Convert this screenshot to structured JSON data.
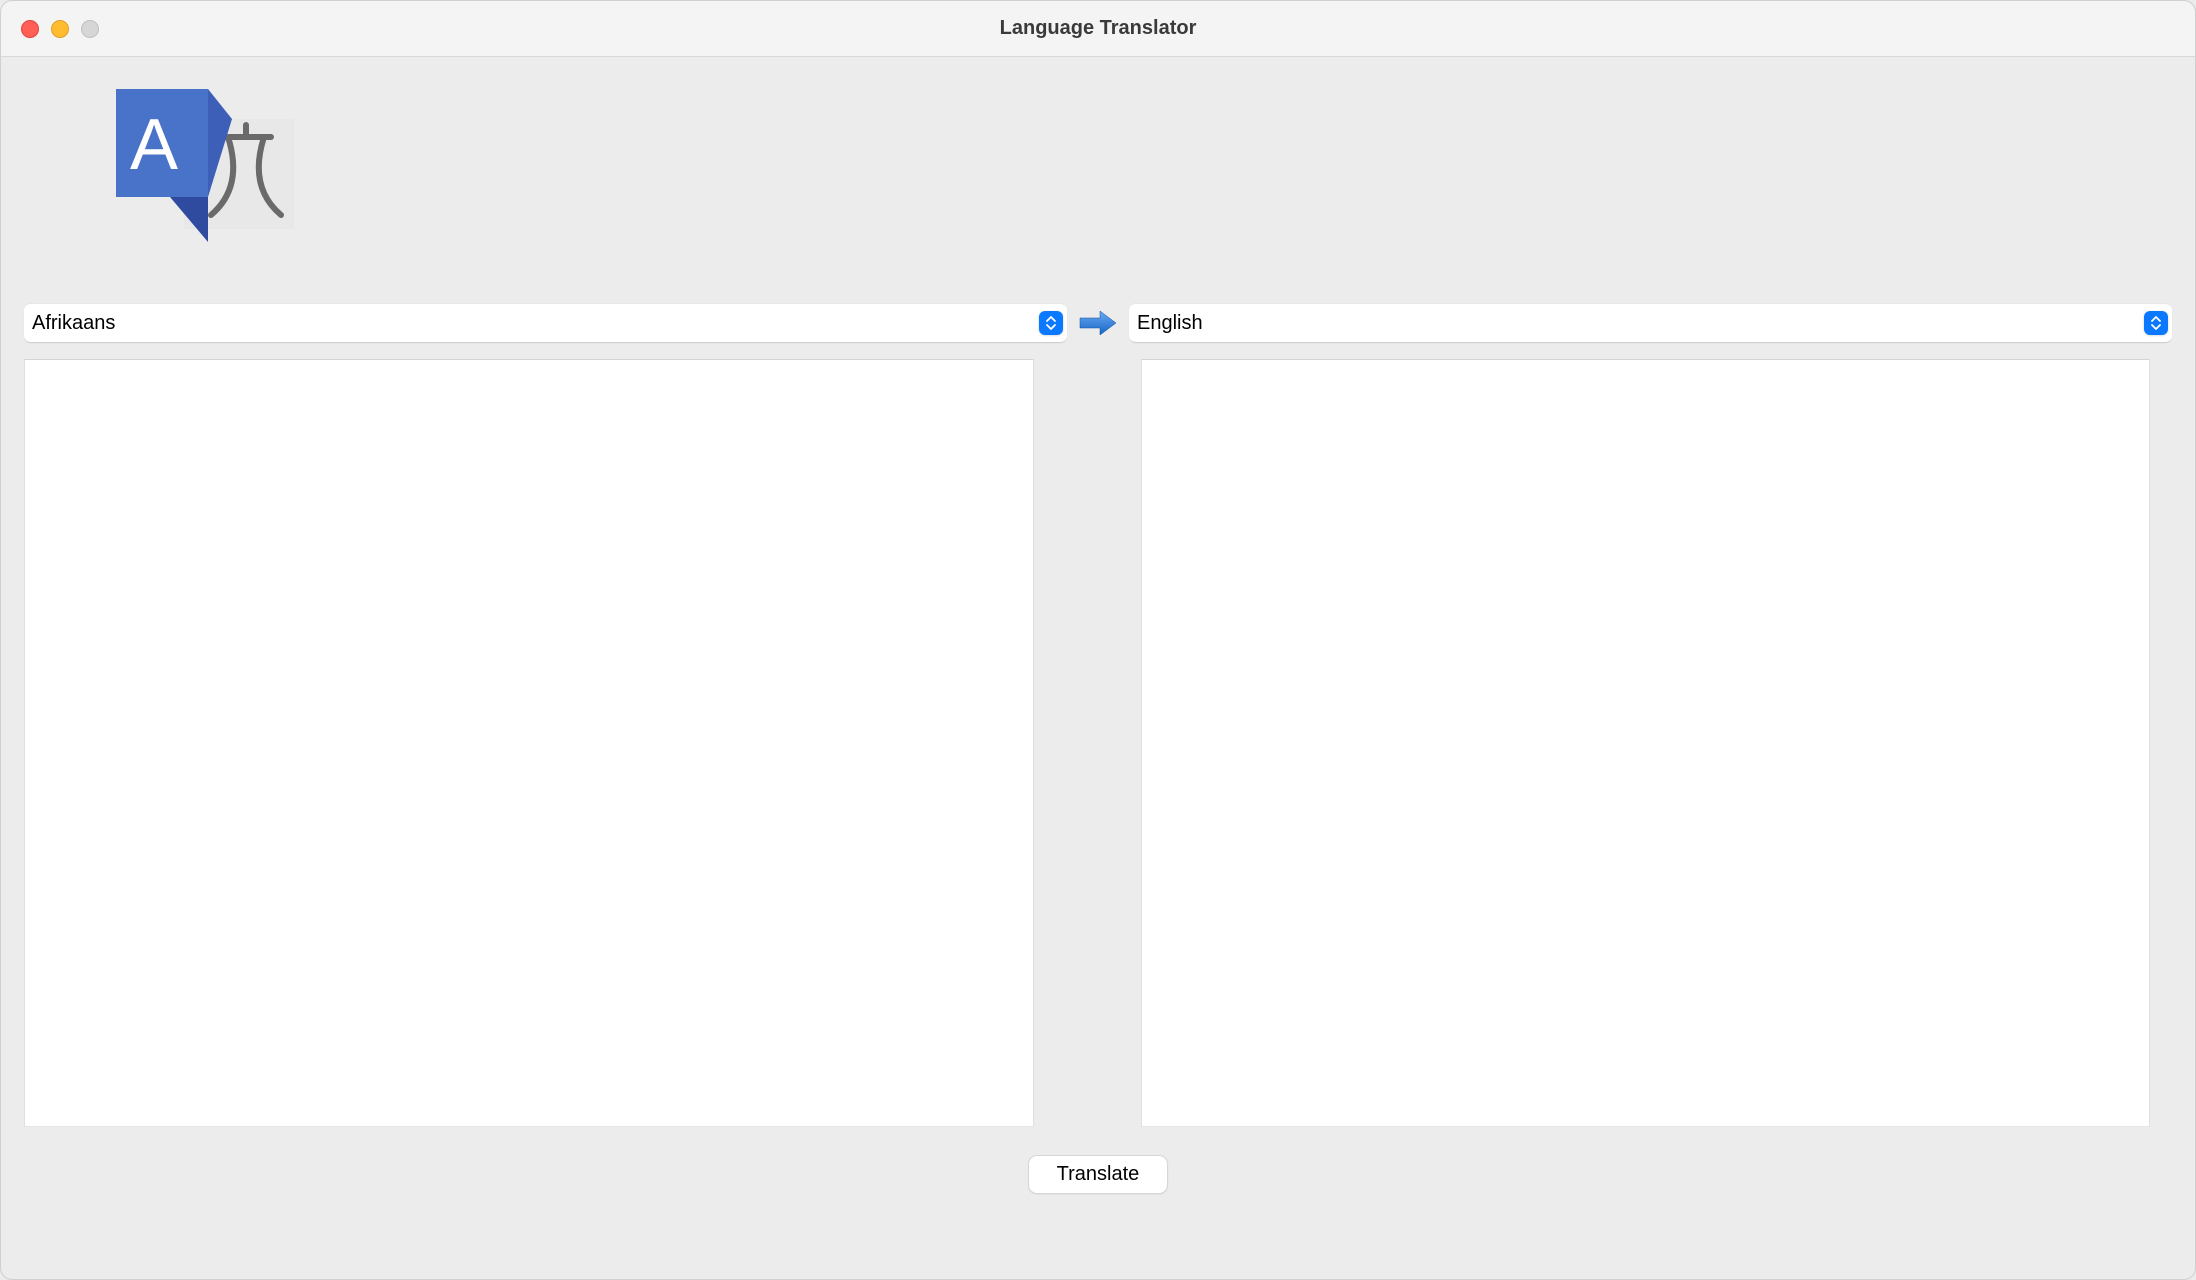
{
  "window": {
    "title": "Language Translator"
  },
  "source": {
    "language": "Afrikaans",
    "text": ""
  },
  "target": {
    "language": "English",
    "text": ""
  },
  "actions": {
    "translate_label": "Translate"
  }
}
